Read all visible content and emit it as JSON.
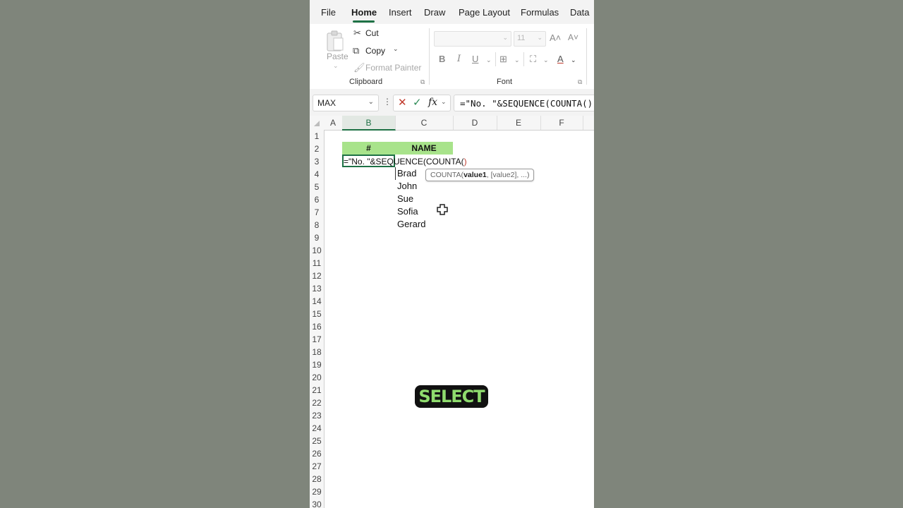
{
  "ribbon_tabs": [
    "File",
    "Home",
    "Insert",
    "Draw",
    "Page Layout",
    "Formulas",
    "Data"
  ],
  "active_tab": "Home",
  "clipboard": {
    "paste_label": "Paste",
    "cut_label": "Cut",
    "copy_label": "Copy",
    "format_painter_label": "Format Painter",
    "group_label": "Clipboard"
  },
  "font": {
    "font_name": "",
    "font_size": "11",
    "group_label": "Font"
  },
  "formula_bar": {
    "name_box": "MAX",
    "formula": "=\"No. \"&SEQUENCE(COUNTA()"
  },
  "columns": [
    "A",
    "B",
    "C",
    "D",
    "E",
    "F"
  ],
  "selected_column": "B",
  "rows": [
    "1",
    "2",
    "3",
    "4",
    "5",
    "6",
    "7",
    "8",
    "9",
    "10",
    "11",
    "12",
    "13",
    "14",
    "15",
    "16",
    "17",
    "18",
    "19",
    "20",
    "21",
    "22",
    "23",
    "24",
    "25",
    "26",
    "27",
    "28",
    "29",
    "30"
  ],
  "table": {
    "header_hash": "#",
    "header_name": "NAME",
    "names": [
      "Brad",
      "John",
      "Sue",
      "Sofia",
      "Gerard"
    ]
  },
  "editing": {
    "cell_text": "=\"No. \"&SEQUENCE(COUNTA(",
    "closing_paren": ")",
    "tooltip_fn": "COUNTA(",
    "tooltip_arg1": "value1",
    "tooltip_rest": ", [value2], ...)"
  },
  "overlay_caption": "SELECT",
  "colors": {
    "header_fill": "#a8e38b",
    "accent": "#1e7145",
    "caption_text": "#8fdc6e"
  }
}
